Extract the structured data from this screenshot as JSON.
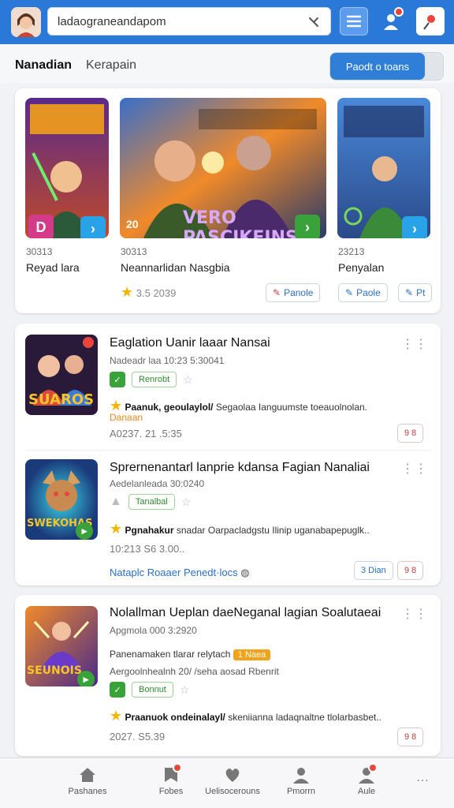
{
  "header": {
    "search_query": "ladaograneandapom",
    "colors": {
      "bar": "#2a78d8",
      "badge": "#e8453c"
    }
  },
  "tabs": [
    {
      "label": "Nanadian"
    },
    {
      "label": "Kerapain"
    }
  ],
  "toggle_label": "Paodt o toans",
  "featured": [
    {
      "code": "30313",
      "title": "Reyad lara",
      "tag": "D"
    },
    {
      "code": "30313",
      "title": "Neannarlidan Nasgbia",
      "tag": "20",
      "art_text": "VERO PASCIKEINS",
      "rating": "3.5 2039",
      "button": "Panole"
    },
    {
      "code": "23213",
      "title": "Penyalan",
      "button": "Paole",
      "button2": "Pt"
    }
  ],
  "list": [
    {
      "title": "Eaglation Uanir laaar Nansai",
      "sub": "Nadeadr laa 10:23 5:30041",
      "badge": "Renrobt",
      "desc_bold": "Paanuk, geoulaylol/",
      "desc": "Segaolaa Ianguumste toeauolnolan.",
      "orange": "Danaan",
      "meta": "A0237. 21 .5:35",
      "btn": "9 8",
      "thumb_text": "SUAROS"
    },
    {
      "title": "Sprernenantarl lanprie kdansa Fagian Nanaliai",
      "sub": "Aedelanleada 30:0240",
      "badge": "Tanalbal",
      "desc_bold": "Pgnahakur",
      "desc": "snadar Oarpacladgstu Ilinip uganabapepuglk..",
      "meta": "10:213 S6 3.00..",
      "links": "Nataplc Roaaer Penedt·locs",
      "btn_blue": "3 Dian",
      "btn": "9 8",
      "thumb_text": "SWEKOHAS"
    },
    {
      "title": "Nolallman Ueplan daeNeganal lagian Soalutaeai",
      "sub": "Apgmola 000 3:2920",
      "line2": "Panenamaken tlarar relytach",
      "chip": "1 Naea",
      "line3": "Aergoolnhealnh 20/ /seha aosad Rbenrit",
      "badge": "Bonnut",
      "desc_bold": "Praanuok ondeinalayl/",
      "desc": "skeniianna ladaqnaltne tlolarbasbet..",
      "meta": "2027. S5.39",
      "btn": "9 8",
      "thumb_text": "SEUNOIS"
    }
  ],
  "bottom_nav": [
    {
      "label": "Pashanes"
    },
    {
      "label": "Fobes"
    },
    {
      "label": "Uelisocerouns"
    },
    {
      "label": "Pmorrn"
    },
    {
      "label": "Aule"
    }
  ]
}
